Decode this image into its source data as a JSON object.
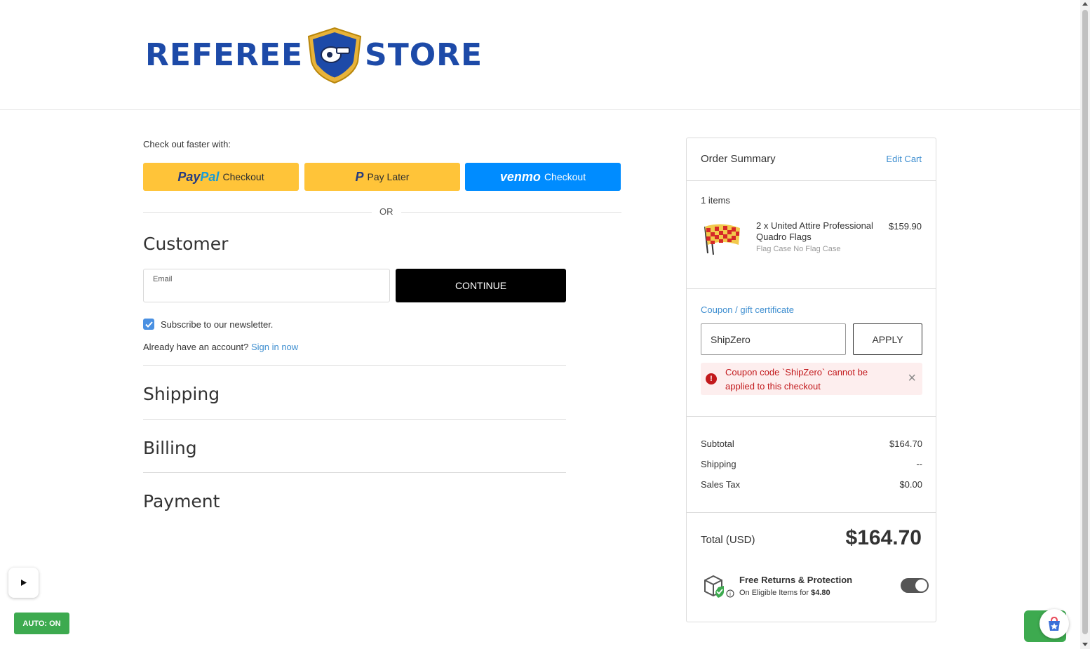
{
  "header": {
    "logo_left": "REFEREE",
    "logo_right": "STORE"
  },
  "checkout": {
    "faster_label": "Check out faster with:",
    "paypal": {
      "brand_pay": "Pay",
      "brand_pal": "Pal",
      "label": "Checkout"
    },
    "paylater": {
      "icon": "P",
      "label": "Pay Later"
    },
    "venmo": {
      "brand": "venmo",
      "label": "Checkout"
    },
    "or_text": "OR"
  },
  "customer": {
    "title": "Customer",
    "email_label": "Email",
    "email_value": "",
    "continue_label": "CONTINUE",
    "newsletter_label": "Subscribe to our newsletter.",
    "newsletter_checked": true,
    "account_prompt": "Already have an account?",
    "sign_in_label": "Sign in now"
  },
  "sections": {
    "shipping": "Shipping",
    "billing": "Billing",
    "payment": "Payment"
  },
  "summary": {
    "title": "Order Summary",
    "edit_cart": "Edit Cart",
    "items_count": "1 items",
    "item": {
      "name": "2 x United Attire Professional Quadro Flags",
      "option": "Flag Case No Flag Case",
      "price": "$159.90"
    },
    "coupon_label": "Coupon / gift certificate",
    "coupon_value": "ShipZero",
    "apply_label": "APPLY",
    "error_text": "Coupon code `ShipZero` cannot be applied to this checkout",
    "close_symbol": "×",
    "lines": [
      {
        "label": "Subtotal",
        "value": "$164.70"
      },
      {
        "label": "Shipping",
        "value": "--"
      },
      {
        "label": "Sales Tax",
        "value": "$0.00"
      }
    ],
    "total_label": "Total (USD)",
    "total_value": "$164.70",
    "protection_title": "Free Returns & Protection",
    "protection_sub_prefix": "On Eligible Items for",
    "protection_price": "$4.80",
    "protection_enabled": true
  },
  "widgets": {
    "auto_label": "AUTO: ON"
  },
  "colors": {
    "brand_blue": "#1d4aa8",
    "link": "#3e8ed0",
    "paypal_yellow": "#ffc439",
    "venmo_blue": "#008cff",
    "error_red": "#c2191c",
    "green": "#3daa4f"
  }
}
